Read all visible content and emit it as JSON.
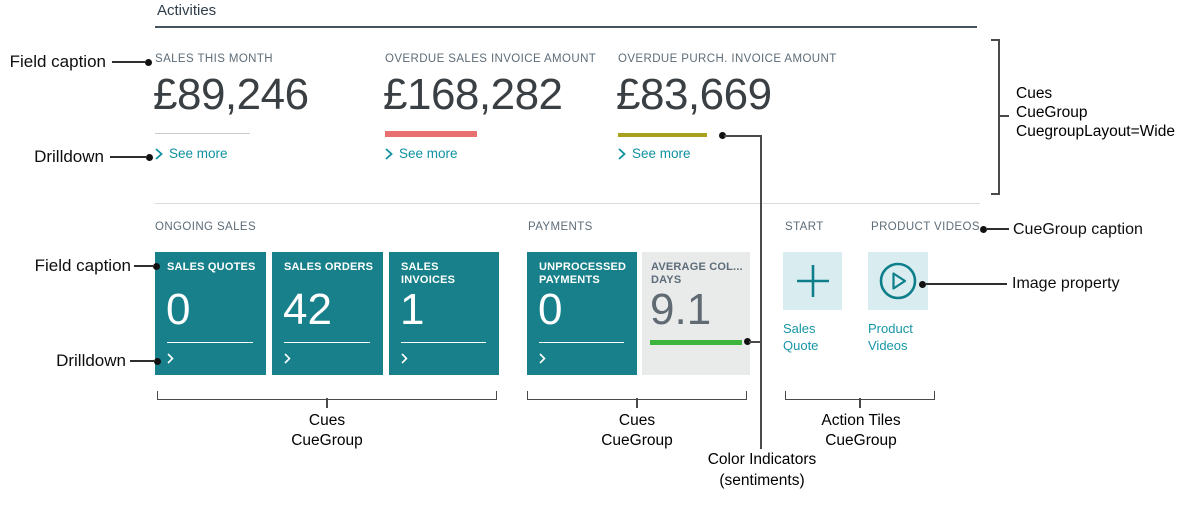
{
  "header": {
    "title": "Activities"
  },
  "wide_cues": [
    {
      "caption": "SALES THIS MONTH",
      "value": "£89,246",
      "link": "See more",
      "indicator": "neutral-gray"
    },
    {
      "caption": "OVERDUE SALES INVOICE AMOUNT",
      "value": "£168,282",
      "link": "See more",
      "indicator": "unfavorable-red"
    },
    {
      "caption": "OVERDUE PURCH. INVOICE AMOUNT",
      "value": "£83,669",
      "link": "See more",
      "indicator": "ambiguous-olive"
    }
  ],
  "cue_groups": [
    {
      "caption": "ONGOING SALES",
      "tiles": [
        {
          "caption": "SALES QUOTES",
          "value": "0"
        },
        {
          "caption": "SALES ORDERS",
          "value": "42"
        },
        {
          "caption": "SALES INVOICES",
          "value": "1"
        }
      ]
    },
    {
      "caption": "PAYMENTS",
      "tiles": [
        {
          "caption": "UNPROCESSED PAYMENTS",
          "value": "0"
        },
        {
          "caption": "AVERAGE COL... DAYS",
          "value": "9.1",
          "indicator": "positive-green"
        }
      ]
    }
  ],
  "action_groups": [
    {
      "caption": "START",
      "label": "Sales Quote",
      "icon": "plus-icon"
    },
    {
      "caption": "PRODUCT VIDEOS",
      "label": "Product Videos",
      "icon": "play-circle-icon"
    }
  ],
  "annotations": {
    "field_caption": "Field caption",
    "drilldown": "Drilldown",
    "cues_wide": {
      "l1": "Cues",
      "l2": "CueGroup",
      "l3": "CuegroupLayout=Wide"
    },
    "cuegroup_caption": "CueGroup caption",
    "image_property": "Image property",
    "cues_group": {
      "l1": "Cues",
      "l2": "CueGroup"
    },
    "action_tiles_group": {
      "l1": "Action Tiles",
      "l2": "CueGroup"
    },
    "color_indicators": {
      "l1": "Color Indicators",
      "l2": "(sentiments)"
    }
  },
  "colors": {
    "tile_teal": "#17808a",
    "neutral_gray_bar": "#c9cdd0",
    "unfavorable_red_bar": "#e87070",
    "ambiguous_olive_bar": "#a8a11b",
    "positive_green_bar": "#3db43d",
    "link_teal": "#0f91a0",
    "action_tile_bg": "#d9edf0",
    "action_icon_teal": "#0e7e8b"
  }
}
